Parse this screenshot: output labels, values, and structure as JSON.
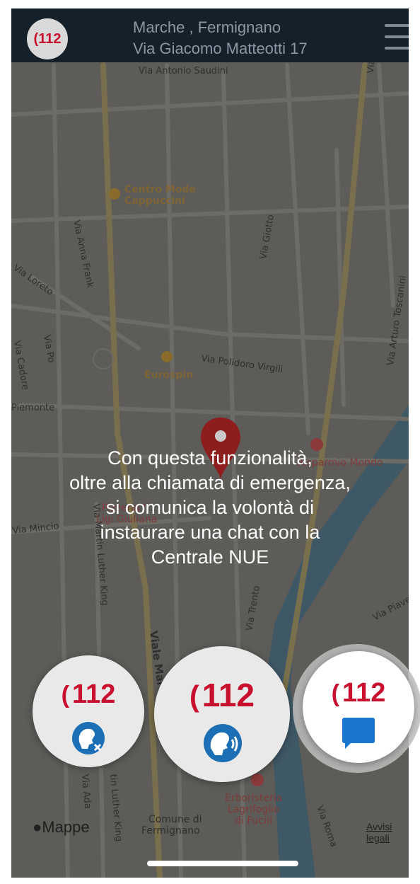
{
  "header": {
    "logo_label": "112",
    "address_line1": "Marche , Fermignano",
    "address_line2": "Via Giacomo Matteotti 17"
  },
  "map": {
    "streets": [
      "Via Antonio Saudini",
      "Via Anna Frank",
      "Via Loreto",
      "Via Giotto",
      "Via Arturo Toscanini",
      "Via Po",
      "Via Cadore",
      "Via Polidoro Virgili",
      "Piemonte",
      "Via Mincio",
      "Via Martin Luther King",
      "Viale Marti",
      "Via Trento",
      "Via Piave",
      "Via Roma",
      "Via Ada",
      "tin Luther King",
      "Via"
    ],
    "pois": [
      "Centro Mode\nCappuccini",
      "Eurospin",
      "Risparmio Mondo",
      "Pizzeria Il",
      "Ligi Giuliana",
      "Erboristeria\nLagrifoglio\ndi Fucili",
      "Comune di\nFermignano"
    ]
  },
  "message_lines": [
    "Con questa funzionalità,",
    "oltre alla chiamata di emergenza,",
    "si comunica la volontà di",
    "instaurare una chat con la",
    "Centrale NUE"
  ],
  "buttons": {
    "silent_call": "112",
    "voice_call": "112",
    "chat_call": "112"
  },
  "footer": {
    "maps_label": "Mappe",
    "legal_link": "Avvisi legali"
  },
  "colors": {
    "brand_red": "#c8102e",
    "accent_blue": "#1876cc",
    "topbar": "#14202a"
  }
}
